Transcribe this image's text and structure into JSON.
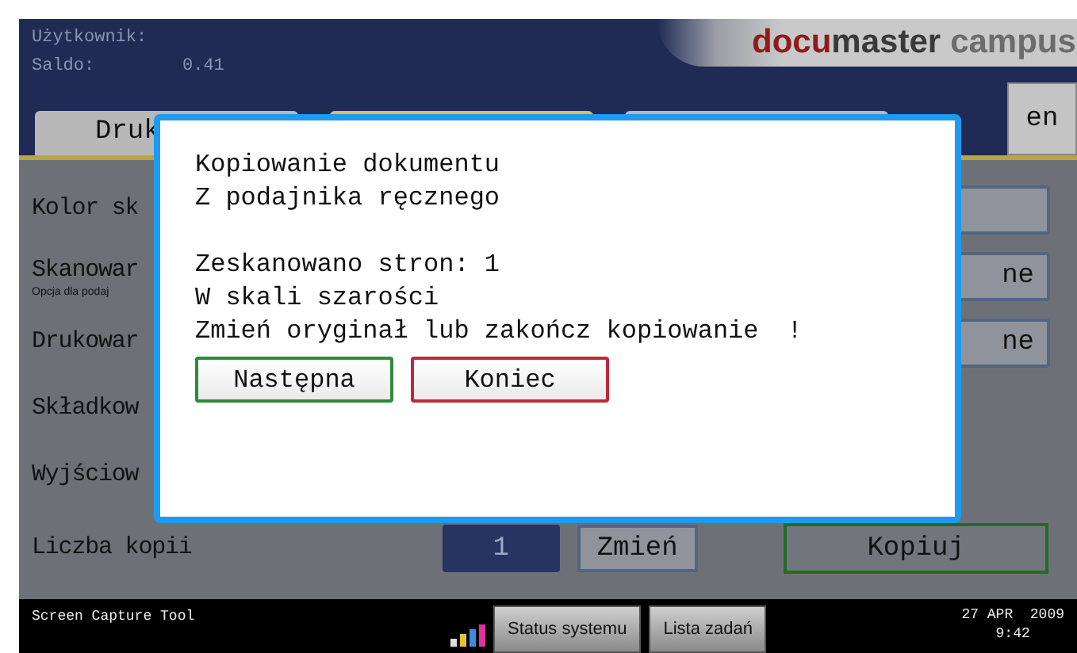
{
  "header": {
    "user_label": "Użytkownik:",
    "balance_label": "Saldo:",
    "balance_value": "0.41",
    "logo": [
      {
        "text": "docu",
        "color": "#8e1c1c"
      },
      {
        "text": "master",
        "color": "#3a3a3a"
      },
      {
        "text": "campus",
        "color": "#6c6c6c"
      }
    ]
  },
  "tabs": [
    {
      "label": "Druk",
      "selected": false
    },
    {
      "selected": true
    },
    {
      "selected": false
    }
  ],
  "language_button": "en",
  "settings": [
    {
      "label": "Kolor sk",
      "blank_button": true
    },
    {
      "label": "Skanowar",
      "note": "Opcja dla podaj",
      "button": "ne"
    },
    {
      "label": "Drukowar",
      "button": "ne"
    },
    {
      "label": "Składkow"
    },
    {
      "label": "Wyjściow"
    }
  ],
  "copies": {
    "label": "Liczba kopii",
    "value": "1",
    "change_button": "Zmień",
    "copy_button": "Kopiuj"
  },
  "dialog": {
    "groups": [
      [
        "Kopiowanie dokumentu",
        "Z podajnika ręcznego"
      ],
      [
        "Zeskanowano stron: 1",
        "W skali szarości",
        "Zmień oryginał lub zakończ kopiowanie"
      ]
    ],
    "alert_mark": "!",
    "buttons": [
      {
        "label": "Następna",
        "kind": "next"
      },
      {
        "label": "Koniec",
        "kind": "end"
      }
    ]
  },
  "taskbar": {
    "app_name": "Screen Capture Tool",
    "buttons": [
      "Status systemu",
      "Lista zadań"
    ],
    "date": "27 APR  2009",
    "time": "9:42"
  }
}
